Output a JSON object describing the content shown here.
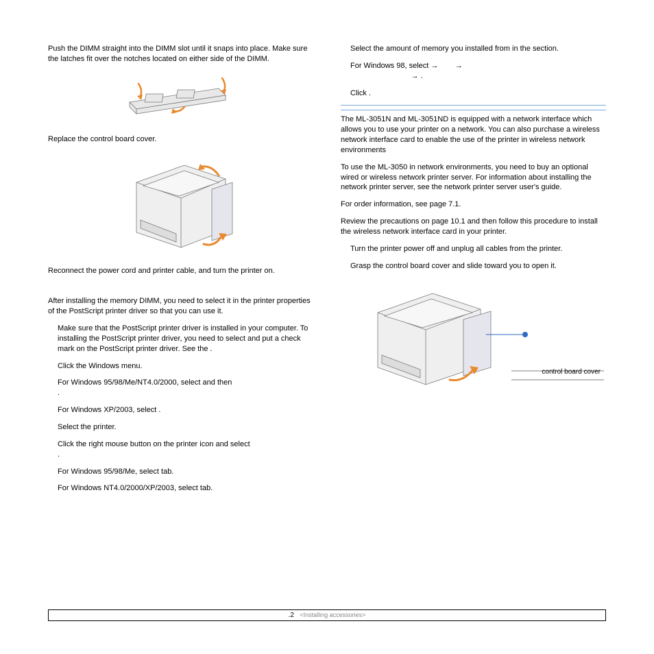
{
  "left": {
    "p1": "Push the DIMM straight into the DIMM slot until it snaps into place. Make sure the latches fit over the notches located on either side of the DIMM.",
    "p2": "Replace the control board cover.",
    "p3": "Reconnect the power cord and printer cable, and turn the printer on.",
    "p4": "After installing the memory DIMM, you need to select it in the printer properties of the PostScript printer driver so that you can use it.",
    "p5a": "Make sure that the PostScript printer driver is installed in your computer. To installing the PostScript printer driver, you need to select ",
    "p5b": " and put a check mark on the PostScript printer driver. See the ",
    "p5c": ".",
    "p6a": "Click the Windows ",
    "p6b": " menu.",
    "p7a": "For Windows 95/98/Me/NT4.0/2000, select ",
    "p7b": " and then ",
    "p7c": ".",
    "p8a": "For Windows XP/2003, select ",
    "p8b": ".",
    "p9a": "Select the ",
    "p9b": " printer.",
    "p10a": "Click the right mouse button on the printer icon and select ",
    "p10b": ".",
    "p11a": "For Windows 95/98/Me, select ",
    "p11b": " tab.",
    "p12a": "For Windows NT4.0/2000/XP/2003, select ",
    "p12b": " tab."
  },
  "right": {
    "p1a": "Select the amount of memory you installed from ",
    "p1b": " in the ",
    "p1c": " section.",
    "p2a": "For Windows 98, select ",
    "p2arrow": "→",
    "p2d": ".",
    "p3a": "Click ",
    "p3b": ".",
    "p4": "The ML-3051N and ML-3051ND is equipped with a network interface which allows you to use your printer on a network. You can also purchase a wireless network interface card to enable the use of the printer in wireless network environments",
    "p5": "To use the ML-3050 in network environments, you need to buy an optional wired or wireless network printer server. For information about installing the network printer server, see the network printer server user's guide.",
    "p6": "For order information, see page 7.1.",
    "p7": "Review the precautions on page 10.1 and then follow this procedure to install the wireless network interface card in your printer.",
    "p8": "Turn the printer power off and unplug all cables from the printer.",
    "p9": "Grasp the control board cover and slide toward you to open it.",
    "callout": "control board cover"
  },
  "footer": {
    "page": ".2",
    "section": "<Installing accessories>"
  }
}
